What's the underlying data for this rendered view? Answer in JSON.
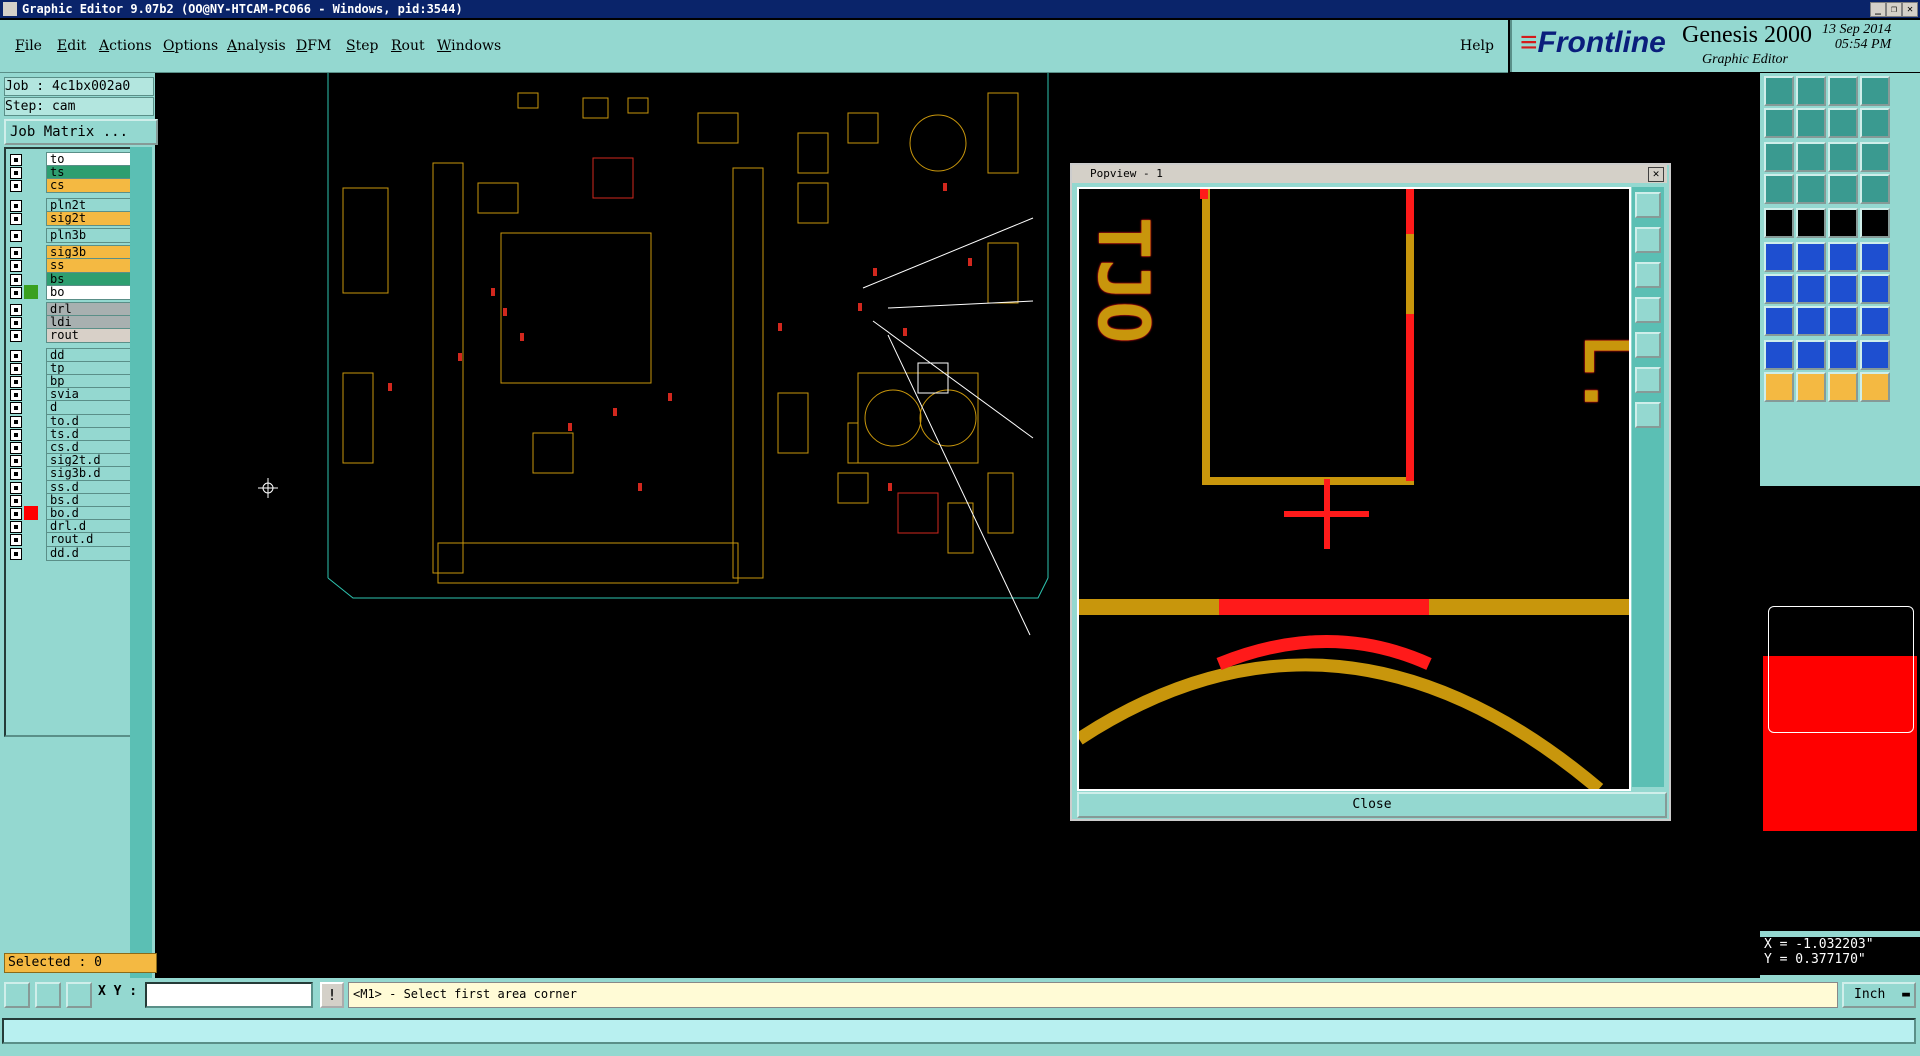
{
  "window": {
    "title": "Graphic Editor 9.07b2 (OO@NY-HTCAM-PC066 - Windows, pid:3544)"
  },
  "menu": [
    "File",
    "Edit",
    "Actions",
    "Options",
    "Analysis",
    "DFM",
    "Step",
    "Rout",
    "Windows"
  ],
  "menu_mnemonics": [
    "F",
    "E",
    "A",
    "O",
    "A",
    "D",
    "S",
    "R",
    "W"
  ],
  "help_label": "Help",
  "brand": {
    "logo": "Frontline",
    "product": "Genesis 2000",
    "subtitle": "Graphic Editor",
    "date": "13 Sep 2014",
    "time": "05:54 PM"
  },
  "job": {
    "job_label": "Job : 4c1bx002a0",
    "step_label": "Step: cam",
    "matrix_button": "Job Matrix ..."
  },
  "layers": [
    {
      "name": "to",
      "bg": "#ffffff",
      "swatch": ""
    },
    {
      "name": "ts",
      "bg": "#2e9e70",
      "swatch": ""
    },
    {
      "name": "cs",
      "bg": "#f4b942",
      "swatch": ""
    },
    {
      "name": "pln2t",
      "bg": "#94d8d0",
      "swatch": ""
    },
    {
      "name": "sig2t",
      "bg": "#f4b942",
      "swatch": ""
    },
    {
      "name": "pln3b",
      "bg": "#94d8d0",
      "swatch": ""
    },
    {
      "name": "sig3b",
      "bg": "#f4b942",
      "swatch": ""
    },
    {
      "name": "ss",
      "bg": "#f4b942",
      "swatch": ""
    },
    {
      "name": "bs",
      "bg": "#2e9e70",
      "swatch": ""
    },
    {
      "name": "bo",
      "bg": "#ffffff",
      "swatch": "#3aa020"
    },
    {
      "name": "drl",
      "bg": "#a8b0b0",
      "swatch": ""
    },
    {
      "name": "ldi",
      "bg": "#a8b0b0",
      "swatch": ""
    },
    {
      "name": "rout",
      "bg": "#d8d0c8",
      "swatch": ""
    },
    {
      "name": "dd",
      "bg": "#94d8d0",
      "swatch": ""
    },
    {
      "name": "tp",
      "bg": "#94d8d0",
      "swatch": ""
    },
    {
      "name": "bp",
      "bg": "#94d8d0",
      "swatch": ""
    },
    {
      "name": "svia",
      "bg": "#94d8d0",
      "swatch": ""
    },
    {
      "name": "d",
      "bg": "#94d8d0",
      "swatch": ""
    },
    {
      "name": "to.d",
      "bg": "#94d8d0",
      "swatch": ""
    },
    {
      "name": "ts.d",
      "bg": "#94d8d0",
      "swatch": ""
    },
    {
      "name": "cs.d",
      "bg": "#94d8d0",
      "swatch": ""
    },
    {
      "name": "sig2t.d",
      "bg": "#94d8d0",
      "swatch": ""
    },
    {
      "name": "sig3b.d",
      "bg": "#94d8d0",
      "swatch": ""
    },
    {
      "name": "ss.d",
      "bg": "#94d8d0",
      "swatch": ""
    },
    {
      "name": "bs.d",
      "bg": "#94d8d0",
      "swatch": ""
    },
    {
      "name": "bo.d",
      "bg": "#94d8d0",
      "swatch": "#ff0000"
    },
    {
      "name": "drl.d",
      "bg": "#94d8d0",
      "swatch": ""
    },
    {
      "name": "rout.d",
      "bg": "#94d8d0",
      "swatch": ""
    },
    {
      "name": "dd.d",
      "bg": "#94d8d0",
      "swatch": ""
    }
  ],
  "selected": "Selected : 0",
  "popview": {
    "title": "Popview - 1",
    "text_top_left": "TJO",
    "text_right": "L.",
    "close_label": "Close"
  },
  "coords": {
    "x": "X = -1.032203\"",
    "y": "Y =  0.377170\""
  },
  "bottom": {
    "xy_label": "X Y :",
    "xy_value": "",
    "prompt": "<M1> - Select first area corner",
    "units": "Inch"
  },
  "colors": {
    "panel": "#94d8d0",
    "board_outline": "#2ec4b0",
    "copper": "#c8960c",
    "highlight": "#ff1a1a"
  }
}
